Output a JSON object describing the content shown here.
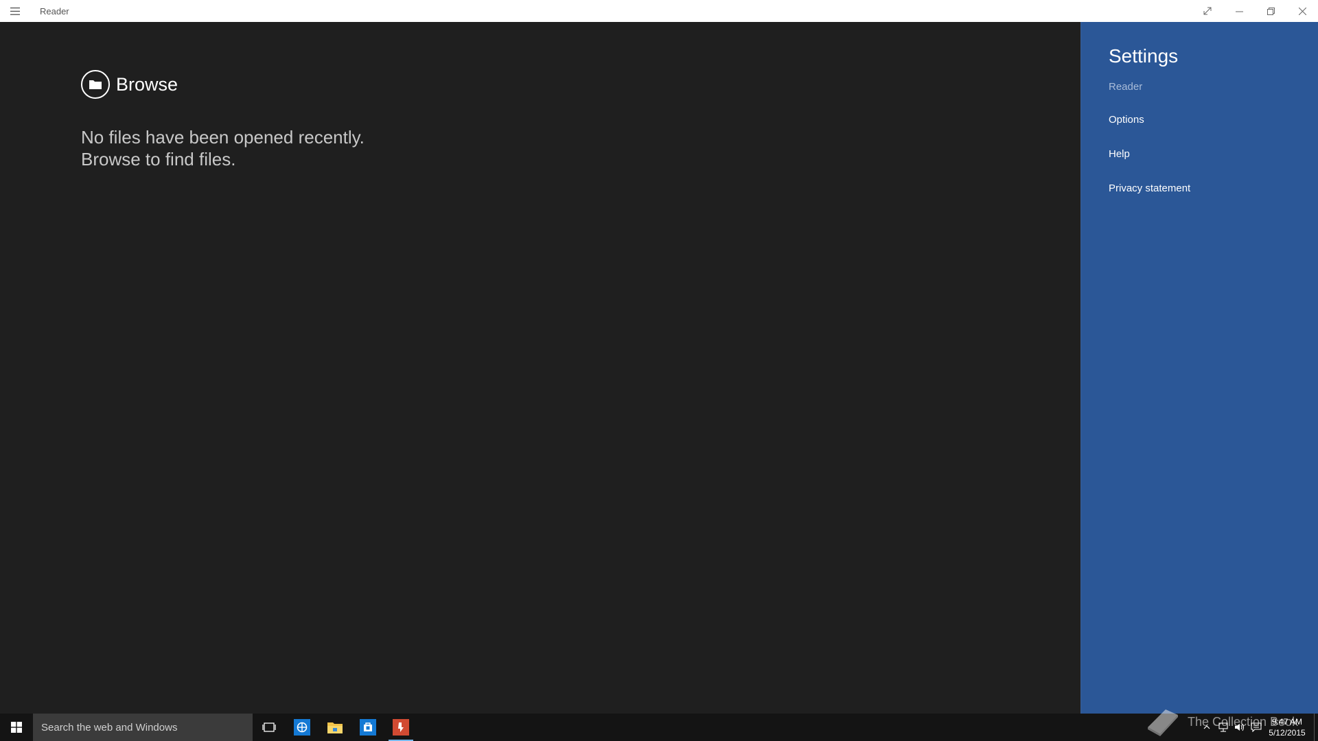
{
  "window": {
    "title": "Reader"
  },
  "main": {
    "browse_label": "Browse",
    "empty_line1": "No files have been opened recently.",
    "empty_line2": "Browse to find files."
  },
  "settings": {
    "title": "Settings",
    "subtitle": "Reader",
    "items": [
      {
        "label": "Options"
      },
      {
        "label": "Help"
      },
      {
        "label": "Privacy statement"
      }
    ]
  },
  "taskbar": {
    "search_placeholder": "Search the web and Windows",
    "pinned": [
      {
        "icon": "task-view-icon"
      },
      {
        "icon": "internet-explorer-icon"
      },
      {
        "icon": "file-explorer-icon"
      },
      {
        "icon": "store-icon"
      },
      {
        "icon": "reader-app-icon",
        "active": true
      }
    ],
    "watermark": "The Collection Book",
    "time": "9:47 AM",
    "date": "5/12/2015"
  },
  "colors": {
    "settings_background": "#2b5797",
    "app_background": "#1f1f1f",
    "taskbar_background": "#141414",
    "reader_accent": "#d14a32"
  }
}
